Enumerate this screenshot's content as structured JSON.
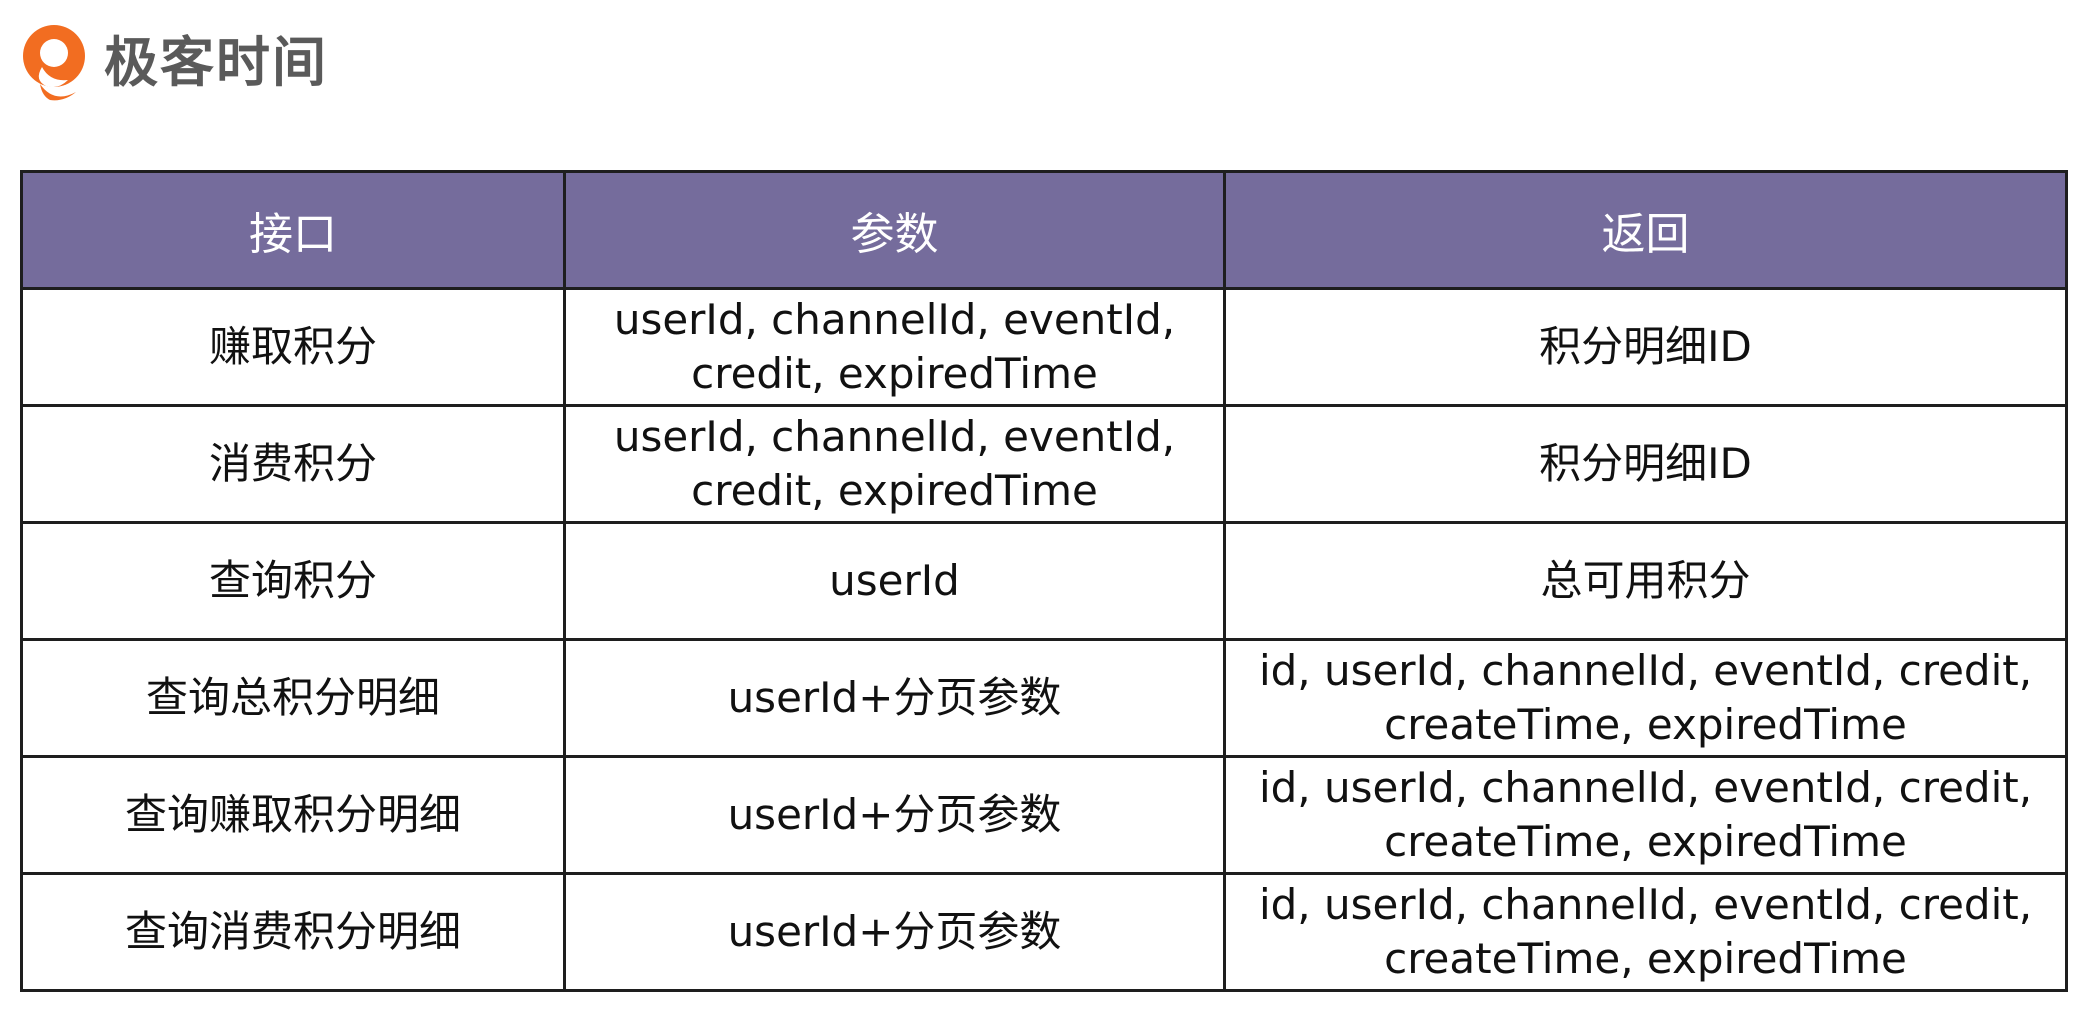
{
  "brand": {
    "logo_text": "极客时间",
    "logo_icon": "geektime-logo-icon",
    "accent_color": "#f26d21"
  },
  "table": {
    "header_color": "#756c9c",
    "headers": [
      "接口",
      "参数",
      "返回"
    ],
    "rows": [
      {
        "interface": "赚取积分",
        "params": [
          "userId, channelId, eventId,",
          "credit, expiredTime"
        ],
        "returns": [
          "积分明细ID"
        ]
      },
      {
        "interface": "消费积分",
        "params": [
          "userId, channelId, eventId,",
          "credit, expiredTime"
        ],
        "returns": [
          "积分明细ID"
        ]
      },
      {
        "interface": "查询积分",
        "params": [
          "userId"
        ],
        "returns": [
          "总可用积分"
        ]
      },
      {
        "interface": "查询总积分明细",
        "params": [
          "userId+分页参数"
        ],
        "returns": [
          "id, userId, channelId, eventId, credit,",
          "createTime, expiredTime"
        ]
      },
      {
        "interface": "查询赚取积分明细",
        "params": [
          "userId+分页参数"
        ],
        "returns": [
          "id, userId, channelId, eventId, credit,",
          "createTime, expiredTime"
        ]
      },
      {
        "interface": "查询消费积分明细",
        "params": [
          "userId+分页参数"
        ],
        "returns": [
          "id, userId, channelId, eventId, credit,",
          "createTime, expiredTime"
        ]
      }
    ]
  }
}
